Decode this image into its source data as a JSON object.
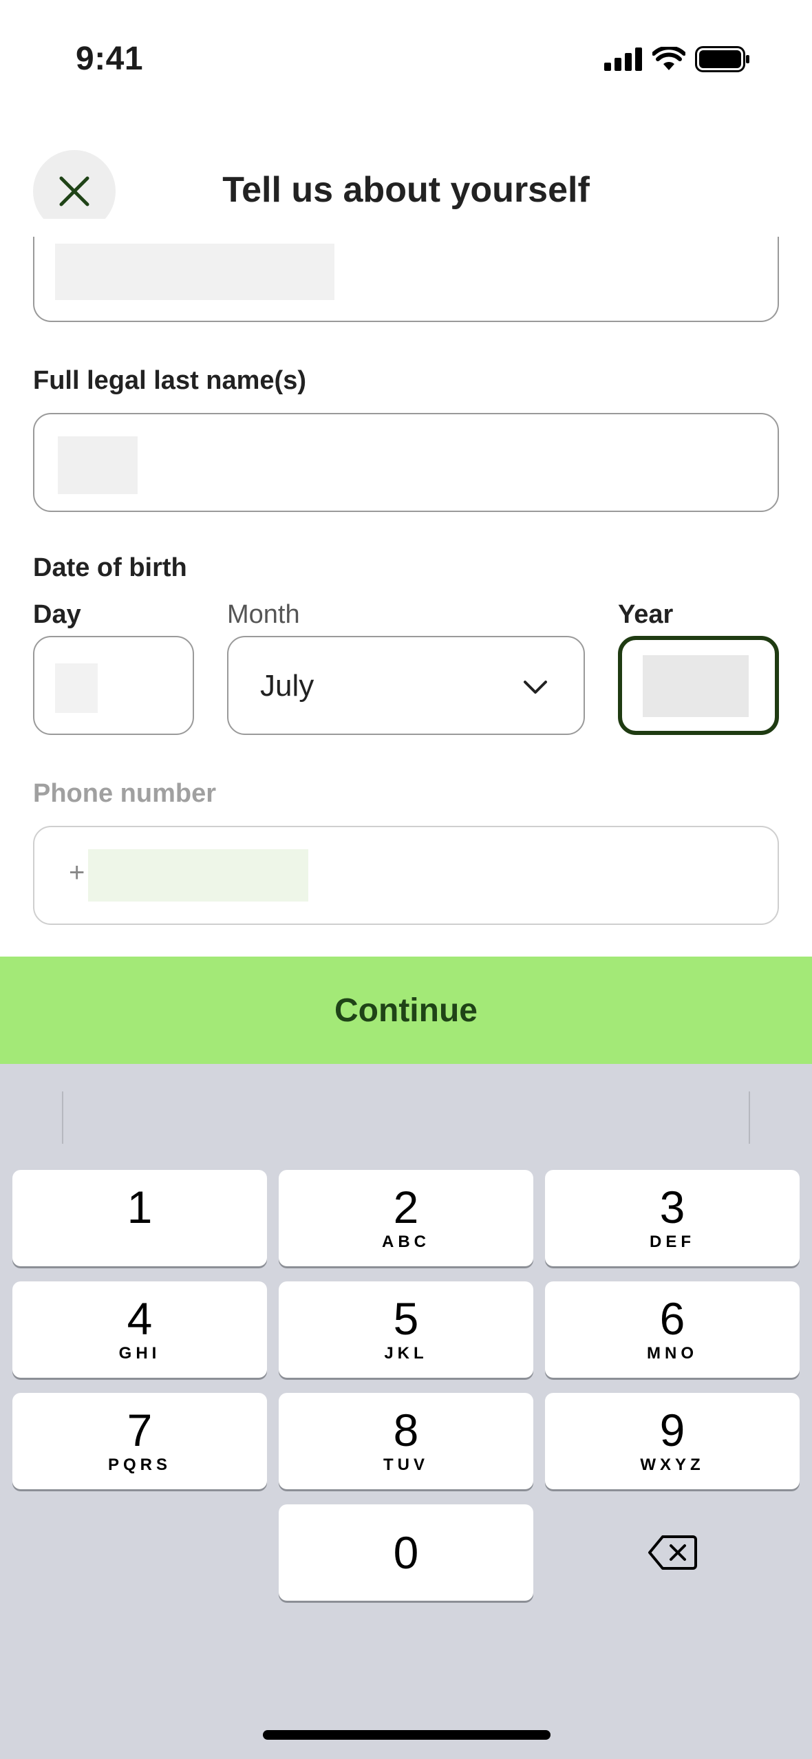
{
  "status_bar": {
    "time": "9:41"
  },
  "header": {
    "title": "Tell us about yourself"
  },
  "form": {
    "last_name_label": "Full legal last name(s)",
    "dob_label": "Date of birth",
    "day_label": "Day",
    "month_label": "Month",
    "month_value": "July",
    "year_label": "Year",
    "phone_label": "Phone number",
    "phone_prefix": "+"
  },
  "continue_label": "Continue",
  "colors": {
    "accent": "#a3e977",
    "accent_text": "#1f4317",
    "focus_border": "#1f3b12"
  },
  "keyboard": {
    "keys": [
      {
        "digit": "1",
        "letters": ""
      },
      {
        "digit": "2",
        "letters": "ABC"
      },
      {
        "digit": "3",
        "letters": "DEF"
      },
      {
        "digit": "4",
        "letters": "GHI"
      },
      {
        "digit": "5",
        "letters": "JKL"
      },
      {
        "digit": "6",
        "letters": "MNO"
      },
      {
        "digit": "7",
        "letters": "PQRS"
      },
      {
        "digit": "8",
        "letters": "TUV"
      },
      {
        "digit": "9",
        "letters": "WXYZ"
      },
      {
        "digit": "0",
        "letters": ""
      }
    ],
    "delete_icon": "backspace-icon"
  }
}
